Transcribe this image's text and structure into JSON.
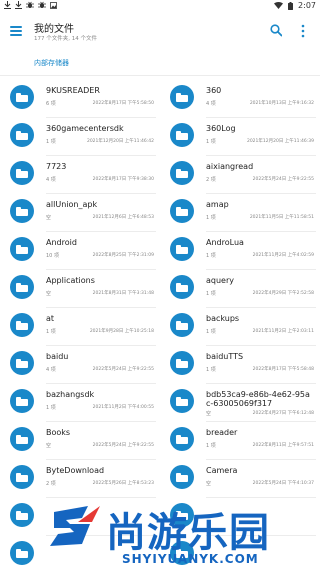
{
  "status_bar": {
    "time": "2:07",
    "left_icons": [
      "download-icon",
      "download-icon",
      "bug-icon",
      "bug-icon",
      "image-icon"
    ],
    "right_icons": [
      "wifi-icon",
      "battery-icon"
    ]
  },
  "header": {
    "title": "我的文件",
    "subtitle": "177 个文件夹, 14 个文件"
  },
  "breadcrumb": {
    "label": "内部存储器"
  },
  "accent_color": "#1a88c9",
  "items": [
    {
      "name": "9KUSREADER",
      "count": "6 项",
      "date": "2022年8月17日 下午5:58:50"
    },
    {
      "name": "360",
      "count": "4 项",
      "date": "2021年10月13日 上午9:16:32"
    },
    {
      "name": "360gamecentersdk",
      "count": "1 项",
      "date": "2021年12月20日 上午11:46:42"
    },
    {
      "name": "360Log",
      "count": "1 项",
      "date": "2021年12月20日 上午11:46:39"
    },
    {
      "name": "7723",
      "count": "4 项",
      "date": "2022年8月17日 下午9:38:30"
    },
    {
      "name": "aixiangread",
      "count": "2 项",
      "date": "2022年5月24日 上午9:22:55"
    },
    {
      "name": "allUnion_apk",
      "count": "空",
      "date": "2021年12月6日 上午6:48:53"
    },
    {
      "name": "amap",
      "count": "1 项",
      "date": "2021年11月5日 上午11:58:51"
    },
    {
      "name": "Android",
      "count": "10 项",
      "date": "2022年8月25日 下午2:31:09"
    },
    {
      "name": "AndroLua",
      "count": "1 项",
      "date": "2021年11月2日 上午4:02:59"
    },
    {
      "name": "Applications",
      "count": "空",
      "date": "2021年8月31日 下午3:31:48"
    },
    {
      "name": "aquery",
      "count": "1 项",
      "date": "2022年4月29日 下午2:52:58"
    },
    {
      "name": "at",
      "count": "1 项",
      "date": "2021年9月28日 上午10:25:18"
    },
    {
      "name": "backups",
      "count": "1 项",
      "date": "2021年11月2日 上午2:03:11"
    },
    {
      "name": "baidu",
      "count": "4 项",
      "date": "2022年5月24日 上午9:22:55"
    },
    {
      "name": "baiduTTS",
      "count": "1 项",
      "date": "2022年8月17日 下午5:58:48"
    },
    {
      "name": "bazhangsdk",
      "count": "1 项",
      "date": "2021年11月2日 下午4:00:55"
    },
    {
      "name": "bdb53ca9-e86b-4e62-95ac-63005069f317",
      "count": "空",
      "date": "2022年4月27日 下午6:12:48"
    },
    {
      "name": "Books",
      "count": "空",
      "date": "2022年5月24日 上午9:22:55"
    },
    {
      "name": "breader",
      "count": "1 项",
      "date": "2022年8月11日 上午9:57:51"
    },
    {
      "name": "ByteDownload",
      "count": "2 项",
      "date": "2022年5月26日 上午8:53:23"
    },
    {
      "name": "Camera",
      "count": "空",
      "date": "2022年5月24日 下午4:10:37"
    },
    {
      "name": "",
      "count": "",
      "date": ""
    },
    {
      "name": "",
      "count": "",
      "date": ""
    },
    {
      "name": "",
      "count": "",
      "date": ""
    },
    {
      "name": "",
      "count": "",
      "date": ""
    }
  ],
  "watermark": {
    "title": "尚游乐园",
    "subtitle": "SHYIYUANYK.COM"
  }
}
